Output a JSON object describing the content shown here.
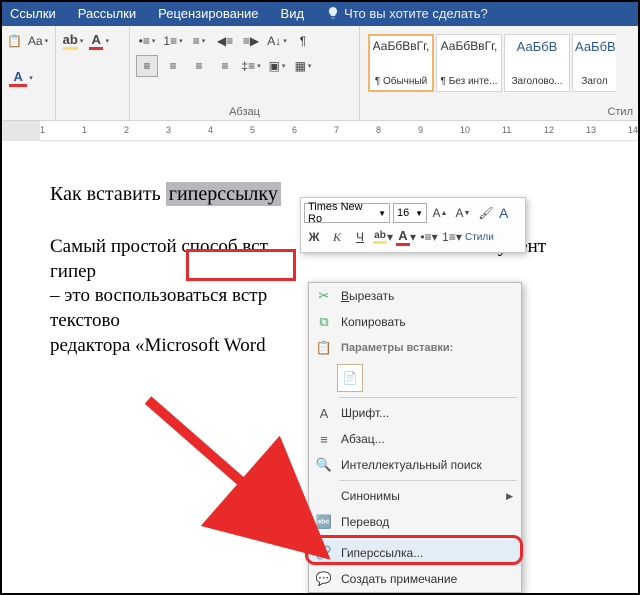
{
  "tabs": {
    "links": "Ссылки",
    "mail": "Рассылки",
    "review": "Рецензирование",
    "view": "Вид",
    "tellme": "Что вы хотите сделать?"
  },
  "ribbon": {
    "para_label": "Абзац",
    "styles_label": "Стил",
    "style1": {
      "sample": "АаБбВвГг,",
      "label": "¶ Обычный"
    },
    "style2": {
      "sample": "АаБбВвГг,",
      "label": "¶ Без инте..."
    },
    "style3": {
      "sample": "АаБбВ",
      "label": "Заголово..."
    },
    "style4": {
      "sample": "АаБбВ",
      "label": "Загол"
    }
  },
  "ruler": [
    "1",
    "1",
    "2",
    "3",
    "4",
    "5",
    "6",
    "7",
    "8",
    "9",
    "10",
    "11",
    "12",
    "13",
    "14"
  ],
  "doc": {
    "title_pre": "Как вставить ",
    "title_hl": "гиперссылку",
    "body1": "Самый простой способ вст",
    "body1b": "умент гипер",
    "body2": "– это воспользоваться встр",
    "body2b": "ами текстово",
    "body3": "редактора «Microsoft Word"
  },
  "mini": {
    "font": "Times New Ro",
    "size": "16",
    "bold": "Ж",
    "italic": "К",
    "under": "Ч",
    "styles": "Стили"
  },
  "ctx": {
    "cut": "Вырезать",
    "copy": "Копировать",
    "paste_hdr": "Параметры вставки:",
    "font": "Шрифт...",
    "para": "Абзац...",
    "smart": "Интеллектуальный поиск",
    "syn": "Синонимы",
    "trans": "Перевод",
    "hyper": "Гиперссылка...",
    "note": "Создать примечание"
  }
}
